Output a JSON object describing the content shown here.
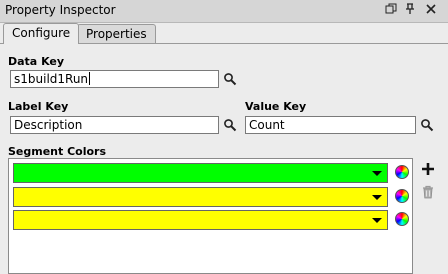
{
  "window": {
    "title": "Property Inspector"
  },
  "tabs": [
    {
      "label": "Configure",
      "active": true
    },
    {
      "label": "Properties",
      "active": false
    }
  ],
  "fields": {
    "data_key": {
      "label": "Data Key",
      "value": "s1build1Run"
    },
    "label_key": {
      "label": "Label Key",
      "value": "Description"
    },
    "value_key": {
      "label": "Value Key",
      "value": "Count"
    }
  },
  "segment_colors": {
    "label": "Segment Colors",
    "items": [
      {
        "color": "#00ff00"
      },
      {
        "color": "#ffff00"
      },
      {
        "color": "#ffff00"
      }
    ]
  },
  "icons": {
    "restore": "restore-icon",
    "pin": "pin-icon",
    "close": "close-icon",
    "search": "search-icon",
    "color_picker": "color-wheel-icon",
    "add": "plus-icon",
    "delete": "trash-icon"
  }
}
